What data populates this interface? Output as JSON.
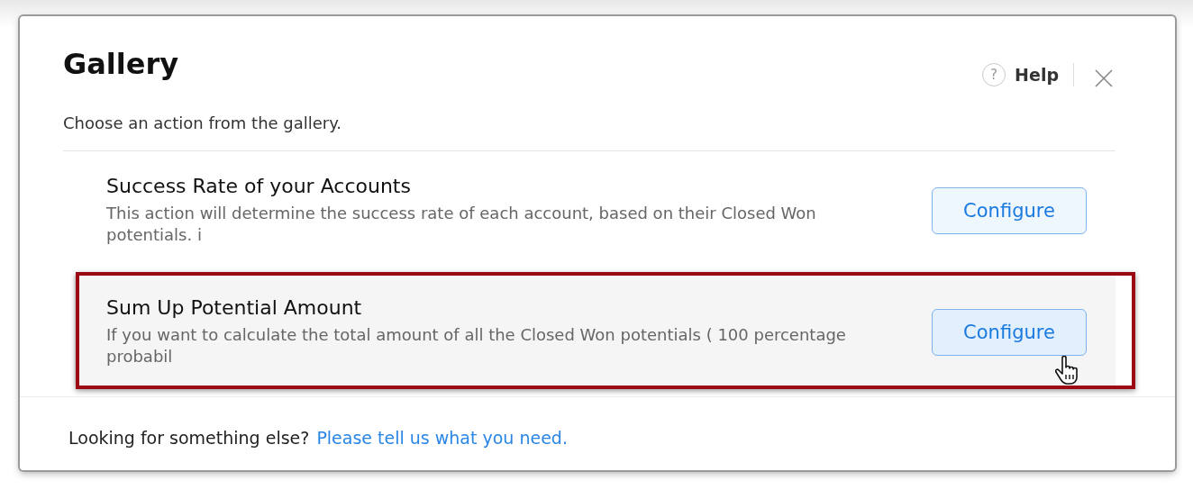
{
  "dialog": {
    "title": "Gallery",
    "subtitle": "Choose an action from the gallery.",
    "help": {
      "icon": "?",
      "label": "Help"
    }
  },
  "actions": [
    {
      "title": "Success Rate of your Accounts",
      "description": "This action will determine the success rate of each account, based on their Closed Won potentials. i",
      "button": "Configure",
      "highlighted": false
    },
    {
      "title": "Sum Up Potential Amount",
      "description": "If you want to calculate the total amount of all the Closed Won potentials ( 100 percentage probabil",
      "button": "Configure",
      "highlighted": true
    }
  ],
  "footer": {
    "text": "Looking for something else?",
    "link": "Please tell us what you need."
  }
}
